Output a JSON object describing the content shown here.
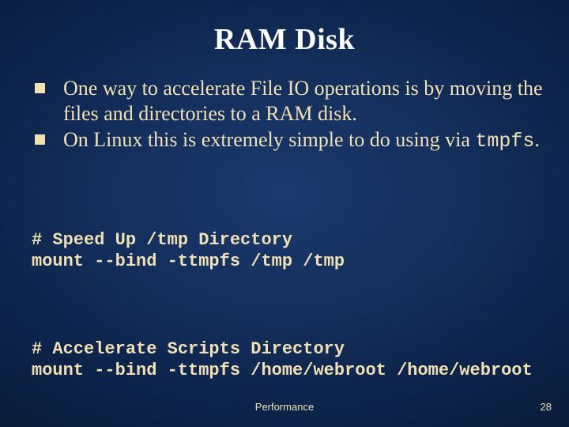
{
  "title": "RAM Disk",
  "bullets": [
    {
      "text": "One way to accelerate File IO operations is by moving the files and directories to a RAM disk."
    },
    {
      "text_pre": "On Linux this is extremely simple to do using via ",
      "code": "tmpfs",
      "text_post": "."
    }
  ],
  "code": {
    "sections": [
      {
        "comment": "# Speed Up /tmp Directory",
        "command": "mount --bind -ttmpfs /tmp /tmp"
      },
      {
        "comment": "# Accelerate Scripts Directory",
        "command": "mount --bind -ttmpfs /home/webroot /home/webroot"
      }
    ]
  },
  "footer": {
    "center": "Performance",
    "page": "28"
  }
}
